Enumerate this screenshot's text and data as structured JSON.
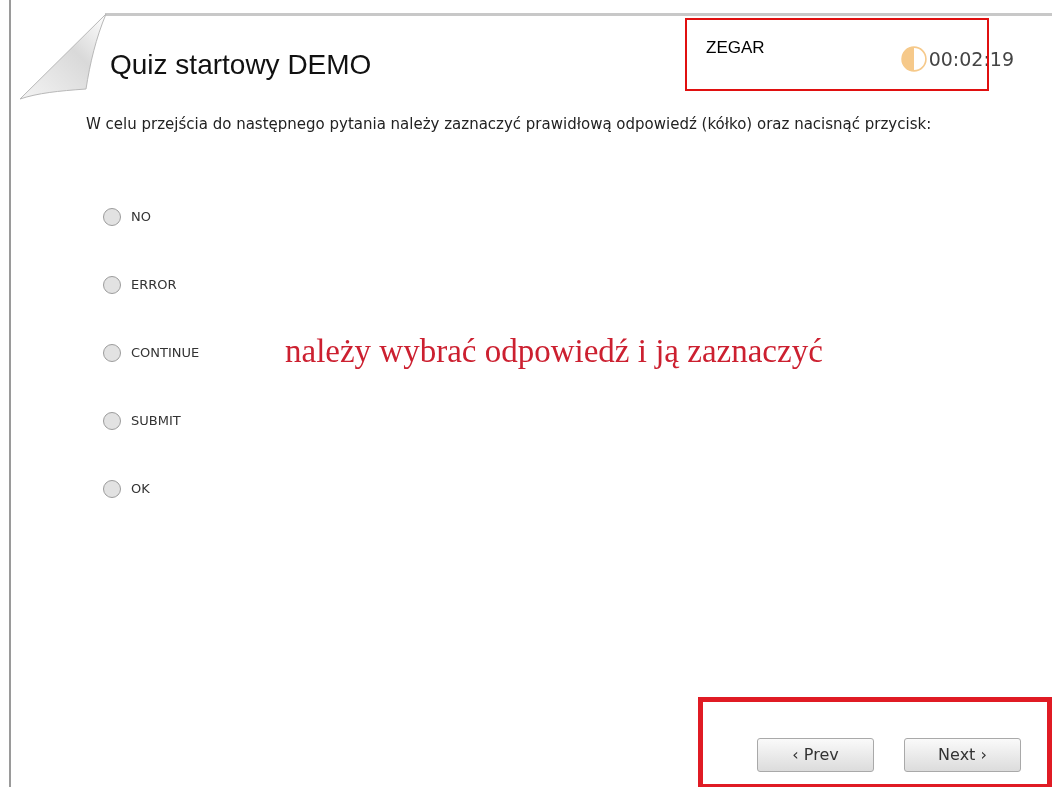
{
  "quiz": {
    "title": "Quiz startowy DEMO",
    "instruction": "W celu przejścia do następnego pytania należy zaznaczyć prawidłową odpowiedź (kółko) oraz nacisnąć przycisk:",
    "options": [
      {
        "label": "NO",
        "selected": false
      },
      {
        "label": "ERROR",
        "selected": false
      },
      {
        "label": "CONTINUE",
        "selected": false
      },
      {
        "label": "SUBMIT",
        "selected": false
      },
      {
        "label": "OK",
        "selected": false
      }
    ],
    "timer": {
      "time": "00:02:19"
    },
    "buttons": [
      {
        "label": "‹ Prev"
      },
      {
        "label": "Next ›"
      }
    ]
  },
  "annotations": {
    "timer_label": "ZEGAR",
    "hint": "należy wybrać odpowiedź i ją zaznaczyć"
  }
}
